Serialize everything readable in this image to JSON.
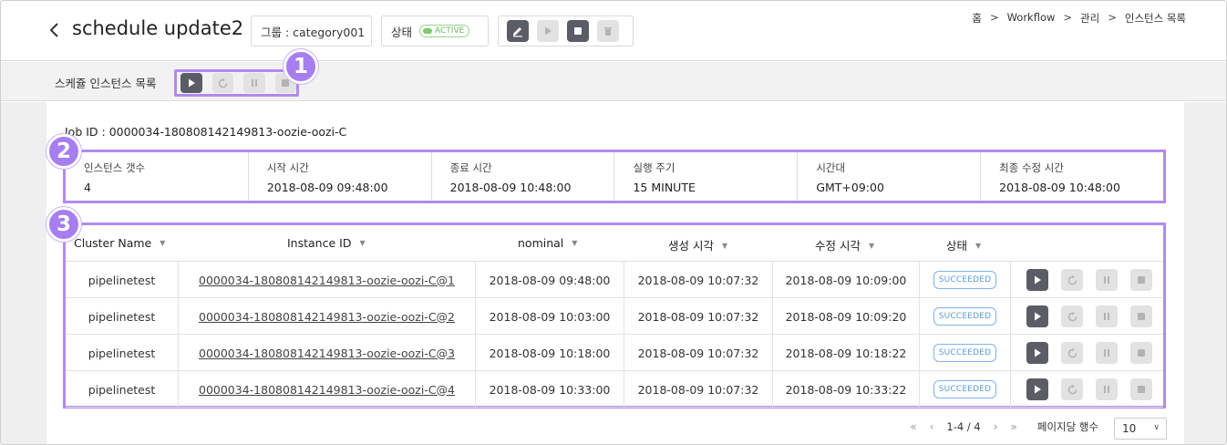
{
  "header": {
    "title": "schedule update2",
    "group_text": "그룹 : category001",
    "state_label": "상태",
    "state_badge": "ACTIVE",
    "breadcrumb": [
      "홈",
      "Workflow",
      "관리",
      "인스턴스 목록"
    ]
  },
  "toolbar": {
    "label": "스케쥴 인스턴스 목록"
  },
  "callouts": [
    "1",
    "2",
    "3"
  ],
  "job": {
    "id_text": "Job ID : 0000034-180808142149813-oozie-oozi-C"
  },
  "info": [
    {
      "label": "인스턴스 갯수",
      "value": "4"
    },
    {
      "label": "시작 시간",
      "value": "2018-08-09 09:48:00"
    },
    {
      "label": "종료 시간",
      "value": "2018-08-09 10:48:00"
    },
    {
      "label": "실행 주기",
      "value": "15 MINUTE"
    },
    {
      "label": "시간대",
      "value": "GMT+09:00"
    },
    {
      "label": "최종 수정 시간",
      "value": "2018-08-09 10:48:00"
    }
  ],
  "table": {
    "columns": [
      "Cluster Name",
      "Instance ID",
      "nominal",
      "생성 시각",
      "수정 시각",
      "상태"
    ],
    "rows": [
      {
        "cluster": "pipelinetest",
        "instance": "0000034-180808142149813-oozie-oozi-C@1",
        "nominal": "2018-08-09 09:48:00",
        "created": "2018-08-09 10:07:32",
        "modified": "2018-08-09 10:09:00",
        "status": "SUCCEEDED"
      },
      {
        "cluster": "pipelinetest",
        "instance": "0000034-180808142149813-oozie-oozi-C@2",
        "nominal": "2018-08-09 10:03:00",
        "created": "2018-08-09 10:07:32",
        "modified": "2018-08-09 10:09:20",
        "status": "SUCCEEDED"
      },
      {
        "cluster": "pipelinetest",
        "instance": "0000034-180808142149813-oozie-oozi-C@3",
        "nominal": "2018-08-09 10:18:00",
        "created": "2018-08-09 10:07:32",
        "modified": "2018-08-09 10:18:22",
        "status": "SUCCEEDED"
      },
      {
        "cluster": "pipelinetest",
        "instance": "0000034-180808142149813-oozie-oozi-C@4",
        "nominal": "2018-08-09 10:33:00",
        "created": "2018-08-09 10:07:32",
        "modified": "2018-08-09 10:33:22",
        "status": "SUCCEEDED"
      }
    ]
  },
  "pagination": {
    "range": "1-4",
    "separator": "/",
    "total": "4",
    "per_page_label": "페이지당 행수",
    "per_page_value": "10"
  },
  "icons": {
    "back": "chevron-left-icon",
    "edit": "edit-icon",
    "play": "play-icon",
    "stop": "stop-icon",
    "delete": "trash-icon",
    "rerun": "rerun-icon",
    "pause": "pause-icon"
  },
  "colors": {
    "highlight": "#b18af0",
    "callout": "#a67ef0",
    "dark_button": "#5a5d66",
    "light_button": "#e2e2e2",
    "active_green": "#7fca6c",
    "succeeded_blue": "#5b9bd9"
  }
}
